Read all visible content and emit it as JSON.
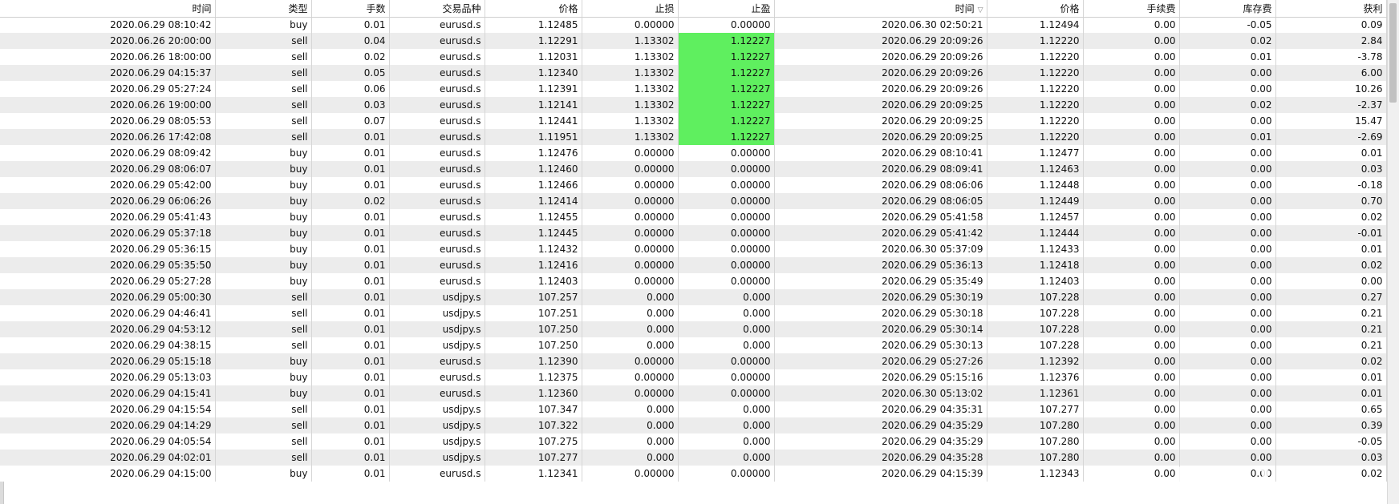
{
  "columns": [
    "时间",
    "类型",
    "手数",
    "交易品种",
    "价格",
    "止损",
    "止盈",
    "时间",
    "价格",
    "手续费",
    "库存费",
    "获利"
  ],
  "sort_indicator": "▽",
  "colors": {
    "tp_highlight": "#5fef5f",
    "row_alt": "#ececec"
  },
  "rows": [
    {
      "open_time": "2020.06.29 08:10:42",
      "type": "buy",
      "volume": "0.01",
      "symbol": "eurusd.s",
      "open_price": "1.12485",
      "sl": "0.00000",
      "tp": "0.00000",
      "tp_hit": false,
      "close_time": "2020.06.30 02:50:21",
      "close_price": "1.12494",
      "commission": "0.00",
      "swap": "-0.05",
      "profit": "0.09"
    },
    {
      "open_time": "2020.06.26 20:00:00",
      "type": "sell",
      "volume": "0.04",
      "symbol": "eurusd.s",
      "open_price": "1.12291",
      "sl": "1.13302",
      "tp": "1.12227",
      "tp_hit": true,
      "close_time": "2020.06.29 20:09:26",
      "close_price": "1.12220",
      "commission": "0.00",
      "swap": "0.02",
      "profit": "2.84"
    },
    {
      "open_time": "2020.06.26 18:00:00",
      "type": "sell",
      "volume": "0.02",
      "symbol": "eurusd.s",
      "open_price": "1.12031",
      "sl": "1.13302",
      "tp": "1.12227",
      "tp_hit": true,
      "close_time": "2020.06.29 20:09:26",
      "close_price": "1.12220",
      "commission": "0.00",
      "swap": "0.01",
      "profit": "-3.78"
    },
    {
      "open_time": "2020.06.29 04:15:37",
      "type": "sell",
      "volume": "0.05",
      "symbol": "eurusd.s",
      "open_price": "1.12340",
      "sl": "1.13302",
      "tp": "1.12227",
      "tp_hit": true,
      "close_time": "2020.06.29 20:09:26",
      "close_price": "1.12220",
      "commission": "0.00",
      "swap": "0.00",
      "profit": "6.00"
    },
    {
      "open_time": "2020.06.29 05:27:24",
      "type": "sell",
      "volume": "0.06",
      "symbol": "eurusd.s",
      "open_price": "1.12391",
      "sl": "1.13302",
      "tp": "1.12227",
      "tp_hit": true,
      "close_time": "2020.06.29 20:09:26",
      "close_price": "1.12220",
      "commission": "0.00",
      "swap": "0.00",
      "profit": "10.26"
    },
    {
      "open_time": "2020.06.26 19:00:00",
      "type": "sell",
      "volume": "0.03",
      "symbol": "eurusd.s",
      "open_price": "1.12141",
      "sl": "1.13302",
      "tp": "1.12227",
      "tp_hit": true,
      "close_time": "2020.06.29 20:09:25",
      "close_price": "1.12220",
      "commission": "0.00",
      "swap": "0.02",
      "profit": "-2.37"
    },
    {
      "open_time": "2020.06.29 08:05:53",
      "type": "sell",
      "volume": "0.07",
      "symbol": "eurusd.s",
      "open_price": "1.12441",
      "sl": "1.13302",
      "tp": "1.12227",
      "tp_hit": true,
      "close_time": "2020.06.29 20:09:25",
      "close_price": "1.12220",
      "commission": "0.00",
      "swap": "0.00",
      "profit": "15.47"
    },
    {
      "open_time": "2020.06.26 17:42:08",
      "type": "sell",
      "volume": "0.01",
      "symbol": "eurusd.s",
      "open_price": "1.11951",
      "sl": "1.13302",
      "tp": "1.12227",
      "tp_hit": true,
      "close_time": "2020.06.29 20:09:25",
      "close_price": "1.12220",
      "commission": "0.00",
      "swap": "0.01",
      "profit": "-2.69"
    },
    {
      "open_time": "2020.06.29 08:09:42",
      "type": "buy",
      "volume": "0.01",
      "symbol": "eurusd.s",
      "open_price": "1.12476",
      "sl": "0.00000",
      "tp": "0.00000",
      "tp_hit": false,
      "close_time": "2020.06.29 08:10:41",
      "close_price": "1.12477",
      "commission": "0.00",
      "swap": "0.00",
      "profit": "0.01"
    },
    {
      "open_time": "2020.06.29 08:06:07",
      "type": "buy",
      "volume": "0.01",
      "symbol": "eurusd.s",
      "open_price": "1.12460",
      "sl": "0.00000",
      "tp": "0.00000",
      "tp_hit": false,
      "close_time": "2020.06.29 08:09:41",
      "close_price": "1.12463",
      "commission": "0.00",
      "swap": "0.00",
      "profit": "0.03"
    },
    {
      "open_time": "2020.06.29 05:42:00",
      "type": "buy",
      "volume": "0.01",
      "symbol": "eurusd.s",
      "open_price": "1.12466",
      "sl": "0.00000",
      "tp": "0.00000",
      "tp_hit": false,
      "close_time": "2020.06.29 08:06:06",
      "close_price": "1.12448",
      "commission": "0.00",
      "swap": "0.00",
      "profit": "-0.18"
    },
    {
      "open_time": "2020.06.29 06:06:26",
      "type": "buy",
      "volume": "0.02",
      "symbol": "eurusd.s",
      "open_price": "1.12414",
      "sl": "0.00000",
      "tp": "0.00000",
      "tp_hit": false,
      "close_time": "2020.06.29 08:06:05",
      "close_price": "1.12449",
      "commission": "0.00",
      "swap": "0.00",
      "profit": "0.70"
    },
    {
      "open_time": "2020.06.29 05:41:43",
      "type": "buy",
      "volume": "0.01",
      "symbol": "eurusd.s",
      "open_price": "1.12455",
      "sl": "0.00000",
      "tp": "0.00000",
      "tp_hit": false,
      "close_time": "2020.06.29 05:41:58",
      "close_price": "1.12457",
      "commission": "0.00",
      "swap": "0.00",
      "profit": "0.02"
    },
    {
      "open_time": "2020.06.29 05:37:18",
      "type": "buy",
      "volume": "0.01",
      "symbol": "eurusd.s",
      "open_price": "1.12445",
      "sl": "0.00000",
      "tp": "0.00000",
      "tp_hit": false,
      "close_time": "2020.06.29 05:41:42",
      "close_price": "1.12444",
      "commission": "0.00",
      "swap": "0.00",
      "profit": "-0.01"
    },
    {
      "open_time": "2020.06.29 05:36:15",
      "type": "buy",
      "volume": "0.01",
      "symbol": "eurusd.s",
      "open_price": "1.12432",
      "sl": "0.00000",
      "tp": "0.00000",
      "tp_hit": false,
      "close_time": "2020.06.30 05:37:09",
      "close_price": "1.12433",
      "commission": "0.00",
      "swap": "0.00",
      "profit": "0.01"
    },
    {
      "open_time": "2020.06.29 05:35:50",
      "type": "buy",
      "volume": "0.01",
      "symbol": "eurusd.s",
      "open_price": "1.12416",
      "sl": "0.00000",
      "tp": "0.00000",
      "tp_hit": false,
      "close_time": "2020.06.29 05:36:13",
      "close_price": "1.12418",
      "commission": "0.00",
      "swap": "0.00",
      "profit": "0.02"
    },
    {
      "open_time": "2020.06.29 05:27:28",
      "type": "buy",
      "volume": "0.01",
      "symbol": "eurusd.s",
      "open_price": "1.12403",
      "sl": "0.00000",
      "tp": "0.00000",
      "tp_hit": false,
      "close_time": "2020.06.29 05:35:49",
      "close_price": "1.12403",
      "commission": "0.00",
      "swap": "0.00",
      "profit": "0.00"
    },
    {
      "open_time": "2020.06.29 05:00:30",
      "type": "sell",
      "volume": "0.01",
      "symbol": "usdjpy.s",
      "open_price": "107.257",
      "sl": "0.000",
      "tp": "0.000",
      "tp_hit": false,
      "close_time": "2020.06.29 05:30:19",
      "close_price": "107.228",
      "commission": "0.00",
      "swap": "0.00",
      "profit": "0.27"
    },
    {
      "open_time": "2020.06.29 04:46:41",
      "type": "sell",
      "volume": "0.01",
      "symbol": "usdjpy.s",
      "open_price": "107.251",
      "sl": "0.000",
      "tp": "0.000",
      "tp_hit": false,
      "close_time": "2020.06.29 05:30:18",
      "close_price": "107.228",
      "commission": "0.00",
      "swap": "0.00",
      "profit": "0.21"
    },
    {
      "open_time": "2020.06.29 04:53:12",
      "type": "sell",
      "volume": "0.01",
      "symbol": "usdjpy.s",
      "open_price": "107.250",
      "sl": "0.000",
      "tp": "0.000",
      "tp_hit": false,
      "close_time": "2020.06.29 05:30:14",
      "close_price": "107.228",
      "commission": "0.00",
      "swap": "0.00",
      "profit": "0.21"
    },
    {
      "open_time": "2020.06.29 04:38:15",
      "type": "sell",
      "volume": "0.01",
      "symbol": "usdjpy.s",
      "open_price": "107.250",
      "sl": "0.000",
      "tp": "0.000",
      "tp_hit": false,
      "close_time": "2020.06.29 05:30:13",
      "close_price": "107.228",
      "commission": "0.00",
      "swap": "0.00",
      "profit": "0.21"
    },
    {
      "open_time": "2020.06.29 05:15:18",
      "type": "buy",
      "volume": "0.01",
      "symbol": "eurusd.s",
      "open_price": "1.12390",
      "sl": "0.00000",
      "tp": "0.00000",
      "tp_hit": false,
      "close_time": "2020.06.29 05:27:26",
      "close_price": "1.12392",
      "commission": "0.00",
      "swap": "0.00",
      "profit": "0.02"
    },
    {
      "open_time": "2020.06.29 05:13:03",
      "type": "buy",
      "volume": "0.01",
      "symbol": "eurusd.s",
      "open_price": "1.12375",
      "sl": "0.00000",
      "tp": "0.00000",
      "tp_hit": false,
      "close_time": "2020.06.29 05:15:16",
      "close_price": "1.12376",
      "commission": "0.00",
      "swap": "0.00",
      "profit": "0.01"
    },
    {
      "open_time": "2020.06.29 04:15:41",
      "type": "buy",
      "volume": "0.01",
      "symbol": "eurusd.s",
      "open_price": "1.12360",
      "sl": "0.00000",
      "tp": "0.00000",
      "tp_hit": false,
      "close_time": "2020.06.30 05:13:02",
      "close_price": "1.12361",
      "commission": "0.00",
      "swap": "0.00",
      "profit": "0.01"
    },
    {
      "open_time": "2020.06.29 04:15:54",
      "type": "sell",
      "volume": "0.01",
      "symbol": "usdjpy.s",
      "open_price": "107.347",
      "sl": "0.000",
      "tp": "0.000",
      "tp_hit": false,
      "close_time": "2020.06.29 04:35:31",
      "close_price": "107.277",
      "commission": "0.00",
      "swap": "0.00",
      "profit": "0.65"
    },
    {
      "open_time": "2020.06.29 04:14:29",
      "type": "sell",
      "volume": "0.01",
      "symbol": "usdjpy.s",
      "open_price": "107.322",
      "sl": "0.000",
      "tp": "0.000",
      "tp_hit": false,
      "close_time": "2020.06.29 04:35:29",
      "close_price": "107.280",
      "commission": "0.00",
      "swap": "0.00",
      "profit": "0.39"
    },
    {
      "open_time": "2020.06.29 04:05:54",
      "type": "sell",
      "volume": "0.01",
      "symbol": "usdjpy.s",
      "open_price": "107.275",
      "sl": "0.000",
      "tp": "0.000",
      "tp_hit": false,
      "close_time": "2020.06.29 04:35:29",
      "close_price": "107.280",
      "commission": "0.00",
      "swap": "0.00",
      "profit": "-0.05"
    },
    {
      "open_time": "2020.06.29 04:02:01",
      "type": "sell",
      "volume": "0.01",
      "symbol": "usdjpy.s",
      "open_price": "107.277",
      "sl": "0.000",
      "tp": "0.000",
      "tp_hit": false,
      "close_time": "2020.06.29 04:35:28",
      "close_price": "107.280",
      "commission": "0.00",
      "swap": "0.00",
      "profit": "0.03"
    },
    {
      "open_time": "2020.06.29 04:15:00",
      "type": "buy",
      "volume": "0.01",
      "symbol": "eurusd.s",
      "open_price": "1.12341",
      "sl": "0.00000",
      "tp": "0.00000",
      "tp_hit": false,
      "close_time": "2020.06.29 04:15:39",
      "close_price": "1.12343",
      "commission": "0.00",
      "swap": "0.00",
      "profit": "0.02"
    }
  ]
}
